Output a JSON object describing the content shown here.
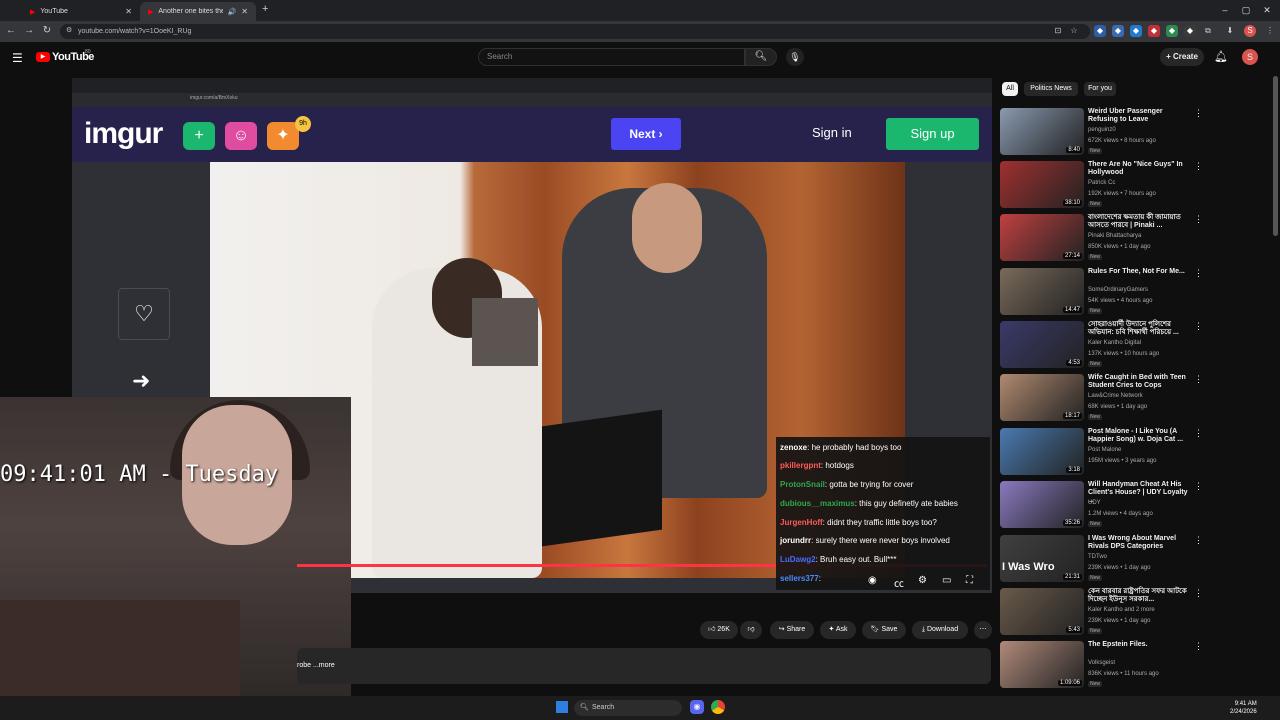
{
  "browser": {
    "tabs": [
      {
        "title": "YouTube",
        "active": false
      },
      {
        "title": "Another one bites the dus",
        "active": true
      }
    ],
    "new_tab": "+",
    "url": "youtube.com/watch?v=1OoeKI_RUg",
    "window_controls": [
      "–",
      "▢",
      "✕"
    ]
  },
  "youtube": {
    "logo": "YouTube",
    "logo_sup": "80",
    "search_placeholder": "Search",
    "create_label": "Create",
    "avatar_letter": "S"
  },
  "video": {
    "inner_url": "imgur.com/a/BmXoku",
    "imgur": {
      "logo": "imgur",
      "badge": "9h",
      "next_label": "Next",
      "signin_label": "Sign in",
      "signup_label": "Sign up"
    },
    "overlay_clock": "09:41:01 AM - Tuesday",
    "chat": [
      {
        "user": "zenoxe",
        "msg": "he probably had boys too",
        "color": "#ffffff"
      },
      {
        "user": "pkillergpnt",
        "msg": "hotdogs",
        "color": "#ff5a5a"
      },
      {
        "user": "ProtonSnail",
        "msg": "gotta be trying for cover",
        "color": "#2fa84f"
      },
      {
        "user": "dubious__maximus",
        "msg": "this guy definetly ate babies",
        "color": "#2fa84f"
      },
      {
        "user": "JurgenHoff",
        "msg": "didnt they traffic little boys too?",
        "color": "#ff5a5a"
      },
      {
        "user": "jorundrr",
        "msg": "surely there were never boys involved",
        "color": "#ffffff"
      },
      {
        "user": "LuDawg2",
        "msg": "Bruh easy out. Bull***",
        "color": "#4b6bff"
      },
      {
        "user": "sellers377",
        "msg": "",
        "color": "#4b8bff"
      }
    ]
  },
  "actions": {
    "like_count": "26K",
    "share_label": "Share",
    "ask_label": "Ask",
    "save_label": "Save",
    "download_label": "Download",
    "more_label": "...more",
    "desc_prefix": "robe"
  },
  "sidebar": {
    "chips": [
      "All",
      "Politics News",
      "For you"
    ],
    "videos": [
      {
        "title": "Weird Uber Passenger Refusing to Leave",
        "channel": "penguinz0",
        "meta": "672K views • 8 hours ago",
        "duration": "8:40",
        "new": true,
        "color": "#8a9ab0"
      },
      {
        "title": "There Are No \"Nice Guys\" In Hollywood",
        "channel": "Patrick Cc",
        "meta": "192K views • 7 hours ago",
        "duration": "38:10",
        "new": true,
        "color": "#a03030"
      },
      {
        "title": "বাংলাদেশের ক্ষমতায় কী জামায়াত আসতে পারবে | Pinaki ...",
        "channel": "Pinaki Bhattacharya",
        "meta": "850K views • 1 day ago",
        "duration": "27:14",
        "new": true,
        "color": "#c04040"
      },
      {
        "title": "Rules For Thee, Not For Me...",
        "channel": "SomeOrdinaryGamers",
        "meta": "54K views • 4 hours ago",
        "duration": "14:47",
        "new": true,
        "color": "#7a6a5a"
      },
      {
        "title": "সোহরাওয়ার্দী উদ্যানে পুলিশের অভিযান: চবি শিক্ষার্থী পরিচয়ে ...",
        "channel": "Kaler Kantho Digital",
        "meta": "137K views • 10 hours ago",
        "duration": "4:53",
        "new": true,
        "color": "#3a3a6a"
      },
      {
        "title": "Wife Caught in Bed with Teen Student Cries to Cops",
        "channel": "Law&Crime Network",
        "meta": "68K views • 1 day ago",
        "duration": "18:17",
        "new": true,
        "color": "#b08a70"
      },
      {
        "title": "Post Malone - I Like You (A Happier Song) w. Doja Cat ...",
        "channel": "Post Malone",
        "meta": "195M views • 3 years ago",
        "duration": "3:18",
        "new": false,
        "color": "#4a7ab0"
      },
      {
        "title": "Will Handyman Cheat At His Client's House? | UDY Loyalty ...",
        "channel": "UDY",
        "meta": "1.2M views • 4 days ago",
        "duration": "35:26",
        "new": true,
        "color": "#8a7ac0"
      },
      {
        "title": "I Was Wrong About Marvel Rivals DPS Categories",
        "channel": "TDTwo",
        "meta": "239K views • 1 day ago",
        "duration": "21:31",
        "new": true,
        "color": "#404040",
        "thumb_text": "I Was Wro"
      },
      {
        "title": "কেন বারবার রাষ্ট্রপতির সফর আটকে দিচ্ছেন ইউনূস সরকার...",
        "channel": "Kaler Kantho and 2 more",
        "meta": "239K views • 1 day ago",
        "duration": "5:43",
        "new": true,
        "color": "#6a5a4a"
      },
      {
        "title": "The Epstein Files.",
        "channel": "Volksgeist",
        "meta": "836K views • 11 hours ago",
        "duration": "1:09:06",
        "new": true,
        "color": "#b08a7a"
      }
    ]
  },
  "taskbar": {
    "search_label": "Search",
    "time": "9:41 AM",
    "date": "2/24/2026"
  }
}
